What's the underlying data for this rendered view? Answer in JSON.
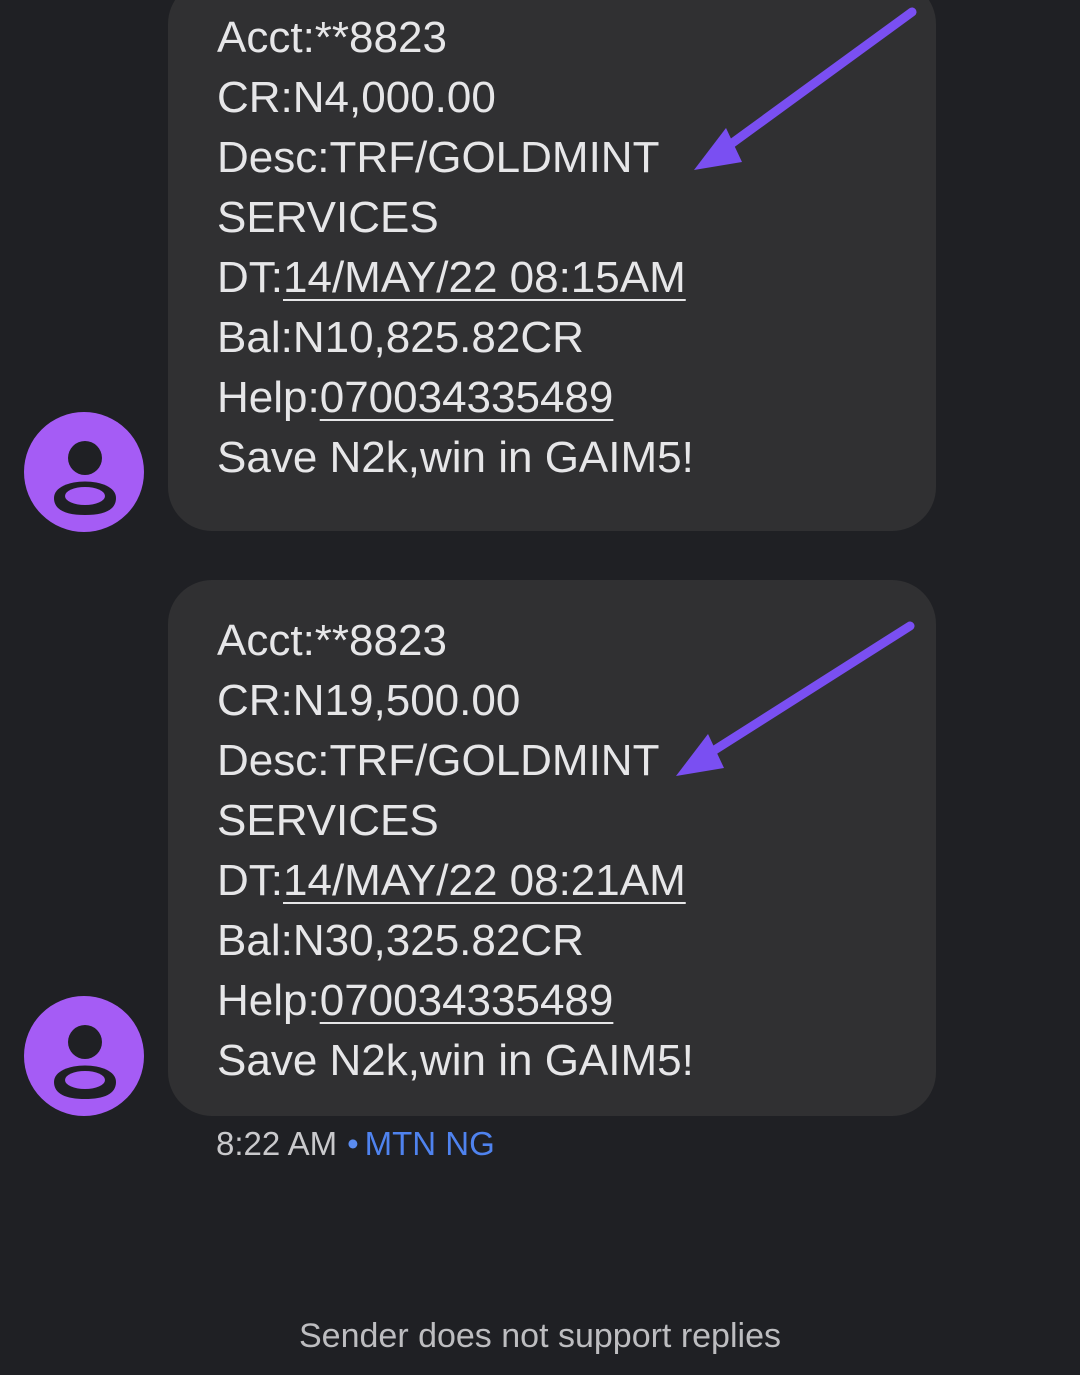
{
  "messages": [
    {
      "acct": "Acct:**8823",
      "cr": "CR:N4,000.00",
      "desc": "Desc:TRF/GOLDMINT",
      "desc2": "SERVICES",
      "dt_prefix": "DT:",
      "dt_value": "14/MAY/22 08:15AM",
      "bal": "Bal:N10,825.82CR",
      "help_prefix": "Help:",
      "help_value": "070034335489",
      "promo": "Save N2k,win in GAIM5!"
    },
    {
      "acct": "Acct:**8823",
      "cr": "CR:N19,500.00",
      "desc": "Desc:TRF/GOLDMINT",
      "desc2": "SERVICES",
      "dt_prefix": "DT:",
      "dt_value": "14/MAY/22 08:21AM",
      "bal": "Bal:N30,325.82CR",
      "help_prefix": "Help:",
      "help_value": "070034335489",
      "promo": "Save N2k,win in GAIM5!"
    }
  ],
  "meta": {
    "time": "8:22 AM",
    "separator": "•",
    "sender": "MTN NG"
  },
  "footer": {
    "text": "Sender does not support replies"
  },
  "colors": {
    "background": "#1f2024",
    "bubble": "#303032",
    "avatar": "#a55cf5",
    "arrow": "#7a4ff2",
    "link": "#4f83ef"
  },
  "icons": {
    "avatar": "person-icon",
    "annotation": "arrow-icon"
  }
}
